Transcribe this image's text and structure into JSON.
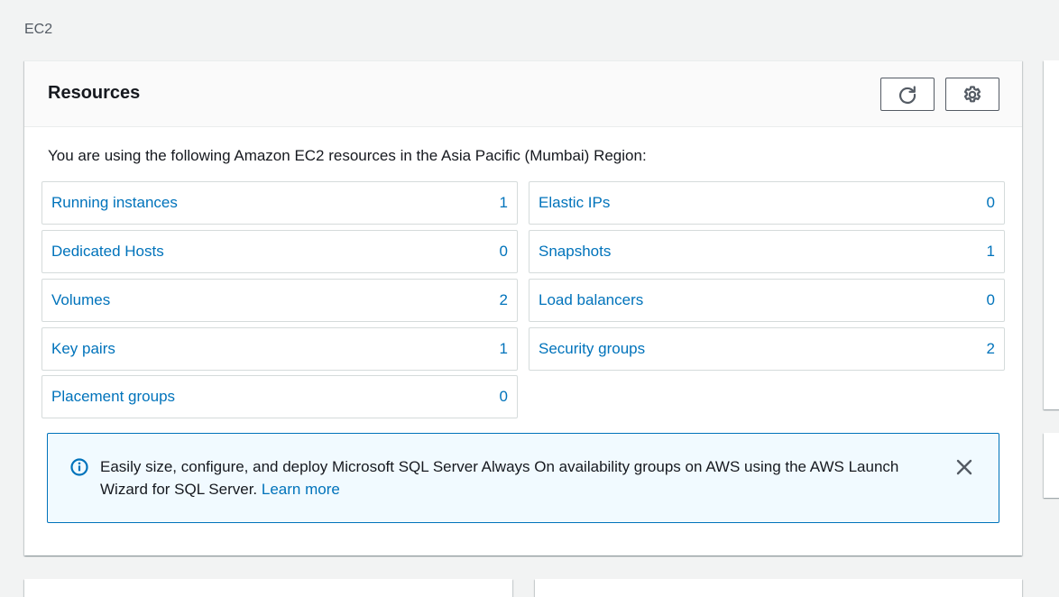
{
  "breadcrumb": "EC2",
  "panel": {
    "title": "Resources",
    "refresh_icon": "refresh-icon",
    "settings_icon": "gear-icon",
    "intro": "You are using the following Amazon EC2 resources in the Asia Pacific (Mumbai) Region:"
  },
  "resources_left": [
    {
      "label": "Running instances",
      "count": "1"
    },
    {
      "label": "Dedicated Hosts",
      "count": "0"
    },
    {
      "label": "Volumes",
      "count": "2"
    },
    {
      "label": "Key pairs",
      "count": "1"
    },
    {
      "label": "Placement groups",
      "count": "0"
    }
  ],
  "resources_right": [
    {
      "label": "Elastic IPs",
      "count": "0"
    },
    {
      "label": "Snapshots",
      "count": "1"
    },
    {
      "label": "Load balancers",
      "count": "0"
    },
    {
      "label": "Security groups",
      "count": "2"
    }
  ],
  "alert": {
    "icon": "info-icon",
    "text": "Easily size, configure, and deploy Microsoft SQL Server Always On availability groups on AWS using the AWS Launch Wizard for SQL Server.",
    "link": "Learn more",
    "close_icon": "close-icon"
  },
  "colors": {
    "link": "#0073bb",
    "alert_bg": "#f1faff",
    "background": "#f2f3f3"
  }
}
